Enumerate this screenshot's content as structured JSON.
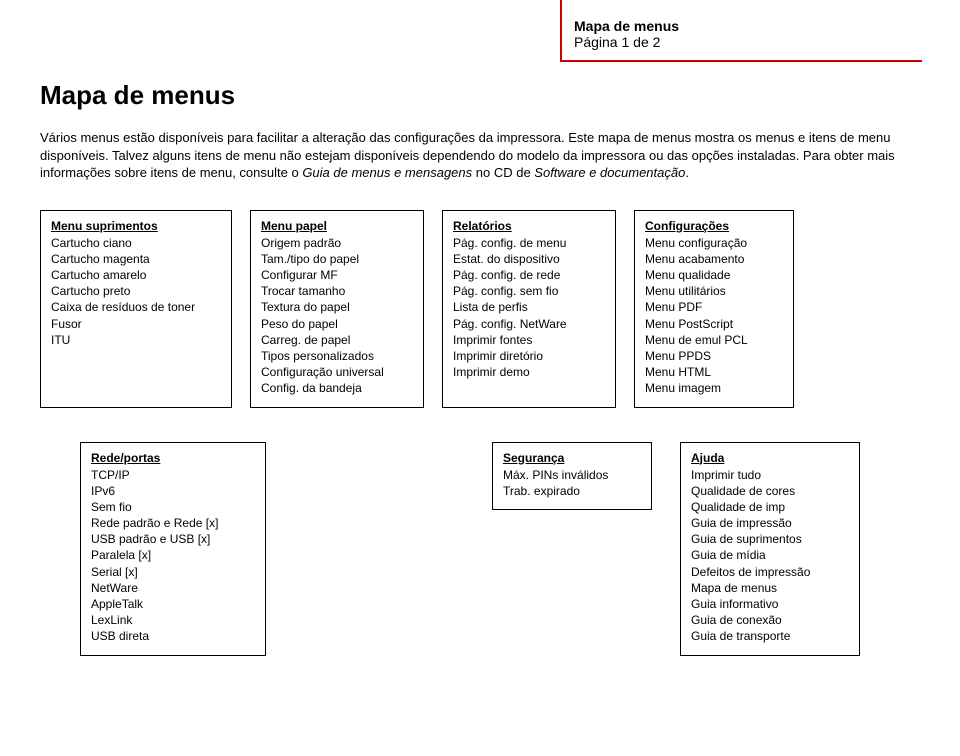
{
  "header": {
    "title": "Mapa de menus",
    "page": "Página 1 de 2"
  },
  "main_title": "Mapa de menus",
  "intro_part1": "Vários menus estão disponíveis para facilitar a alteração das configurações da impressora. Este mapa de menus mostra os menus e itens de menu disponíveis. Talvez alguns itens de menu não estejam disponíveis dependendo do modelo da impressora ou das opções instaladas. Para obter mais informações sobre itens de menu, consulte o ",
  "intro_italic1": "Guia de menus e mensagens",
  "intro_part2": " no CD de ",
  "intro_italic2": "Software e documentação",
  "intro_part3": ".",
  "boxes": {
    "suprimentos": {
      "title": "Menu suprimentos",
      "items": [
        "Cartucho ciano",
        "Cartucho magenta",
        "Cartucho amarelo",
        "Cartucho preto",
        "Caixa de resíduos de toner",
        "Fusor",
        "ITU"
      ]
    },
    "papel": {
      "title": "Menu papel",
      "items": [
        "Origem padrão",
        "Tam./tipo do papel",
        "Configurar MF",
        "Trocar tamanho",
        "Textura do papel",
        "Peso do papel",
        "Carreg. de papel",
        "Tipos personalizados",
        "Configuração universal",
        "Config. da bandeja"
      ]
    },
    "relatorios": {
      "title": "Relatórios",
      "items": [
        "Pág. config. de menu",
        "Estat. do dispositivo",
        "Pág. config. de rede",
        "Pág. config. sem fio",
        "Lista de perfis",
        "Pág. config. NetWare",
        "Imprimir fontes",
        "Imprimir diretório",
        "Imprimir demo"
      ]
    },
    "configuracoes": {
      "title": "Configurações",
      "items": [
        "Menu configuração",
        "Menu acabamento",
        "Menu qualidade",
        "Menu utilitários",
        "Menu PDF",
        "Menu PostScript",
        "Menu de emul PCL",
        "Menu PPDS",
        "Menu HTML",
        "Menu imagem"
      ]
    },
    "rede": {
      "title": "Rede/portas",
      "items": [
        "TCP/IP",
        "IPv6",
        "Sem fio",
        "Rede padrão e Rede [x]",
        "USB padrão e USB [x]",
        "Paralela [x]",
        "Serial [x]",
        "NetWare",
        "AppleTalk",
        "LexLink",
        "USB direta"
      ]
    },
    "seguranca": {
      "title": "Segurança",
      "items": [
        "Máx. PINs inválidos",
        "Trab. expirado"
      ]
    },
    "ajuda": {
      "title": "Ajuda",
      "items": [
        "Imprimir tudo",
        "Qualidade de cores",
        "Qualidade de imp",
        "Guia de impressão",
        "Guia de suprimentos",
        "Guia de mídia",
        "Defeitos de impressão",
        "Mapa de menus",
        "Guia informativo",
        "Guia de conexão",
        "Guia de transporte"
      ]
    }
  }
}
